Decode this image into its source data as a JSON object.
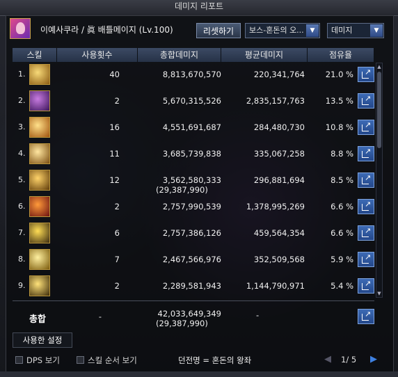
{
  "window": {
    "title": "데미지 리포트"
  },
  "header": {
    "character": "이예사쿠라 / 眞 배틀메이지 (Lv.100)",
    "reset_label": "리셋하기",
    "dungeon_select": "보스-혼돈의 오...",
    "metric_select": "데미지"
  },
  "table": {
    "columns": [
      "스킬",
      "사용횟수",
      "총합데미지",
      "평균데미지",
      "점유율"
    ],
    "rows": [
      {
        "rank": "1.",
        "count": "40",
        "total": "8,813,670,570",
        "avg": "220,341,764",
        "pct": "21.0 %",
        "icon": "staff-strike-icon",
        "c1": "#f7d978",
        "c2": "#8a5a12"
      },
      {
        "rank": "2.",
        "count": "2",
        "total": "5,670,315,526",
        "avg": "2,835,157,763",
        "pct": "13.5 %",
        "icon": "violet-vortex-icon",
        "c1": "#c77be0",
        "c2": "#3a1358"
      },
      {
        "rank": "3.",
        "count": "16",
        "total": "4,551,691,687",
        "avg": "284,480,730",
        "pct": "10.8 %",
        "icon": "golden-burst-icon",
        "c1": "#ffe08a",
        "c2": "#a0520c"
      },
      {
        "rank": "4.",
        "count": "11",
        "total": "3,685,739,838",
        "avg": "335,067,258",
        "pct": "8.8 %",
        "icon": "staff-swing-icon",
        "c1": "#ffe6a0",
        "c2": "#7a4d10"
      },
      {
        "rank": "5.",
        "count": "12",
        "total": "3,562,580,333",
        "total_sub": "(29,387,990)",
        "avg": "296,881,694",
        "pct": "8.5 %",
        "icon": "gold-wave-icon",
        "c1": "#ffd36a",
        "c2": "#5e3a08"
      },
      {
        "rank": "6.",
        "count": "2",
        "total": "2,757,990,539",
        "avg": "1,378,995,269",
        "pct": "6.6 %",
        "icon": "red-orb-icon",
        "c1": "#ff9a3a",
        "c2": "#6a1010"
      },
      {
        "rank": "7.",
        "count": "6",
        "total": "2,757,386,126",
        "avg": "459,564,354",
        "pct": "6.6 %",
        "icon": "chain-ring-icon",
        "c1": "#ffdd55",
        "c2": "#3a2a10"
      },
      {
        "rank": "8.",
        "count": "7",
        "total": "2,467,566,976",
        "avg": "352,509,568",
        "pct": "5.9 %",
        "icon": "lightning-slash-icon",
        "c1": "#fff0a0",
        "c2": "#7a5a0a"
      },
      {
        "rank": "9.",
        "count": "2",
        "total": "2,289,581,943",
        "avg": "1,144,790,971",
        "pct": "5.4 %",
        "icon": "star-cluster-icon",
        "c1": "#ffe27a",
        "c2": "#3c2a08"
      }
    ]
  },
  "total": {
    "label": "총합",
    "count": "-",
    "total": "42,033,649,349",
    "total_sub": "(29,387,990)",
    "avg": "-"
  },
  "settings": {
    "label": "사용한 설정"
  },
  "footer": {
    "dps_label": "DPS 보기",
    "order_label": "스킬 순서 보기",
    "dungeon_name": "던전명 = 혼돈의 왕좌",
    "page": "1/ 5"
  }
}
